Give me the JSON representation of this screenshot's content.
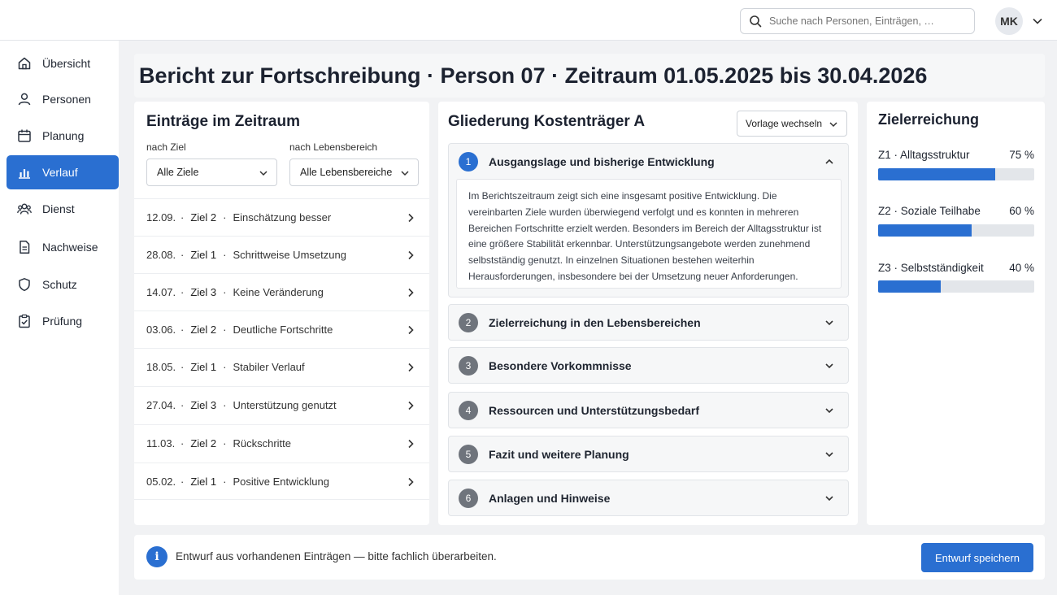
{
  "search": {
    "placeholder": "Suche nach Personen, Einträgen, …"
  },
  "user": {
    "initials": "MK"
  },
  "nav": [
    {
      "label": "Übersicht",
      "icon": "home-icon"
    },
    {
      "label": "Personen",
      "icon": "person-icon"
    },
    {
      "label": "Planung",
      "icon": "calendar-icon"
    },
    {
      "label": "Verlauf",
      "icon": "chart-bar-icon",
      "active": true
    },
    {
      "label": "Dienst",
      "icon": "team-icon"
    },
    {
      "label": "Nachweise",
      "icon": "document-icon"
    },
    {
      "label": "Schutz",
      "icon": "shield-icon"
    },
    {
      "label": "Prüfung",
      "icon": "clipboard-check-icon"
    }
  ],
  "page": {
    "title": "Bericht zur Fortschreibung · Person 07 · Zeitraum 01.05.2025 bis 30.04.2026"
  },
  "entries_panel": {
    "title": "Einträge im Zeitraum",
    "filter_goal_label": "nach Ziel",
    "filter_goal_value": "Alle Ziele",
    "filter_area_label": "nach Lebensbereich",
    "filter_area_value": "Alle Lebensbereiche",
    "separator": "·",
    "items": [
      {
        "date": "12.09.",
        "goal": "Ziel 2",
        "text": "Einschätzung besser"
      },
      {
        "date": "28.08.",
        "goal": "Ziel 1",
        "text": "Schrittweise Umsetzung"
      },
      {
        "date": "14.07.",
        "goal": "Ziel 3",
        "text": "Keine Veränderung"
      },
      {
        "date": "03.06.",
        "goal": "Ziel 2",
        "text": "Deutliche Fortschritte"
      },
      {
        "date": "18.05.",
        "goal": "Ziel 1",
        "text": "Stabiler Verlauf"
      },
      {
        "date": "27.04.",
        "goal": "Ziel 3",
        "text": "Unterstützung genutzt"
      },
      {
        "date": "11.03.",
        "goal": "Ziel 2",
        "text": "Rückschritte"
      },
      {
        "date": "05.02.",
        "goal": "Ziel 1",
        "text": "Positive Entwicklung"
      }
    ]
  },
  "outline": {
    "title": "Gliederung Kostenträger A",
    "template_button": "Vorlage wechseln",
    "sections": [
      {
        "num": "1",
        "title": "Ausgangslage und bisherige Entwicklung",
        "open": true,
        "body": "Im Berichtszeitraum zeigt sich eine insgesamt positive Entwicklung. Die vereinbarten Ziele wurden überwiegend verfolgt und es konnten in mehreren Bereichen Fortschritte erzielt werden. Besonders im Bereich der Alltagsstruktur ist eine größere Stabilität erkennbar. Unterstützungsangebote werden zunehmend selbstständig genutzt. In einzelnen Situationen bestehen weiterhin Herausforderungen, insbesondere bei der Umsetzung neuer Anforderungen."
      },
      {
        "num": "2",
        "title": "Zielerreichung in den Lebensbereichen"
      },
      {
        "num": "3",
        "title": "Besondere Vorkommnisse"
      },
      {
        "num": "4",
        "title": "Ressourcen und Unterstützungsbedarf"
      },
      {
        "num": "5",
        "title": "Fazit und weitere Planung"
      },
      {
        "num": "6",
        "title": "Anlagen und Hinweise"
      }
    ]
  },
  "goals": {
    "title": "Zielerreichung",
    "items": [
      {
        "label": "Z1 · Alltagsstruktur",
        "percent_label": "75 %",
        "value": 0.75
      },
      {
        "label": "Z2 · Soziale Teilhabe",
        "percent_label": "60 %",
        "value": 0.6
      },
      {
        "label": "Z3 · Selbstständigkeit",
        "percent_label": "40 %",
        "value": 0.4
      }
    ]
  },
  "footer": {
    "info_symbol": "i",
    "text": "Entwurf aus vorhandenen Einträgen — bitte fachlich überarbeiten.",
    "save_label": "Entwurf speichern"
  },
  "colors": {
    "accent": "#2a6fd1",
    "number_badge": "#6f747c",
    "bar_track": "#e3e6ea"
  }
}
